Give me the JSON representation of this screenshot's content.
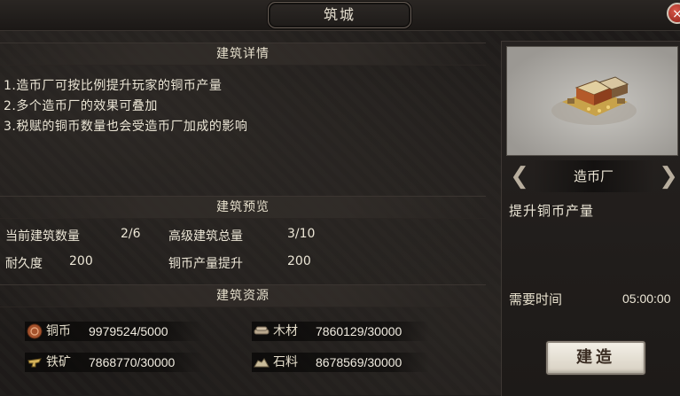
{
  "title": "筑城",
  "close_label": "×",
  "details": {
    "heading": "建筑详情",
    "lines": [
      "1.造币厂可按比例提升玩家的铜币产量",
      "2.多个造币厂的效果可叠加",
      "3.税赋的铜币数量也会受造币厂加成的影响"
    ]
  },
  "preview": {
    "heading": "建筑预览",
    "current_count_label": "当前建筑数量",
    "current_count_value": "2/6",
    "advanced_total_label": "高级建筑总量",
    "advanced_total_value": "3/10",
    "durability_label": "耐久度",
    "durability_value": "200",
    "copper_boost_label": "铜币产量提升",
    "copper_boost_value": "200"
  },
  "resources": {
    "heading": "建筑资源",
    "items": [
      {
        "name": "铜币",
        "value": "9979524/5000",
        "icon": "copper-coin-icon"
      },
      {
        "name": "木材",
        "value": "7860129/30000",
        "icon": "wood-icon"
      },
      {
        "name": "铁矿",
        "value": "7868770/30000",
        "icon": "iron-ore-icon"
      },
      {
        "name": "石料",
        "value": "8678569/30000",
        "icon": "stone-icon"
      }
    ]
  },
  "building": {
    "name": "造币厂",
    "description": "提升铜币产量",
    "time_label": "需要时间",
    "time_value": "05:00:00",
    "build_label": "建造"
  },
  "colors": {
    "accent_text": "#ece6d6",
    "close_red": "#c23a2e"
  }
}
